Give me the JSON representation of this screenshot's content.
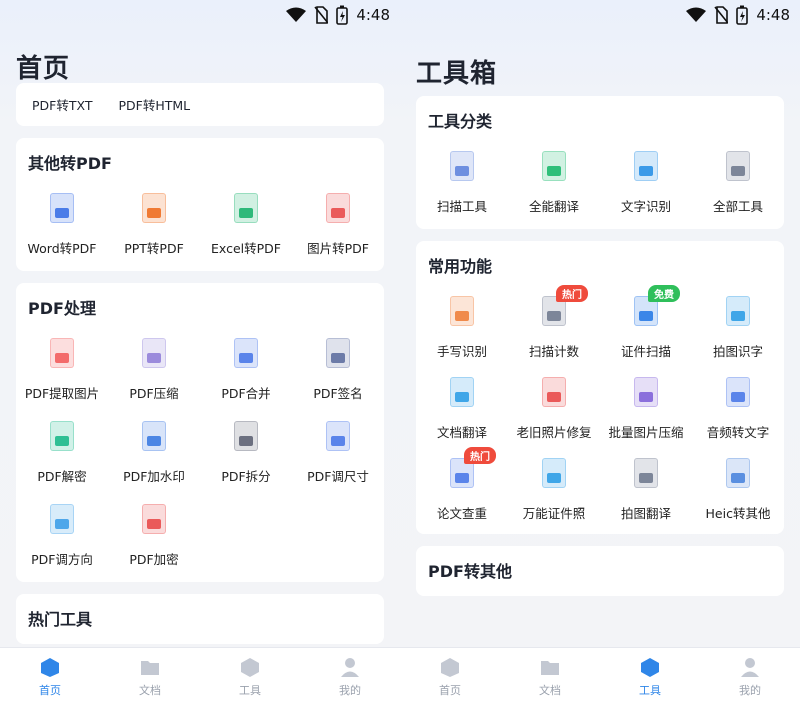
{
  "status": {
    "time": "4:48"
  },
  "left": {
    "title": "首页",
    "top_items": [
      "PDF转TXT",
      "PDF转HTML"
    ],
    "other_to_pdf": {
      "title": "其他转PDF",
      "items": [
        {
          "label": "Word转PDF",
          "icon": "word-to-pdf-icon",
          "color": "#4a7ce8"
        },
        {
          "label": "PPT转PDF",
          "icon": "ppt-to-pdf-icon",
          "color": "#f07a33"
        },
        {
          "label": "Excel转PDF",
          "icon": "excel-to-pdf-icon",
          "color": "#2eb97a"
        },
        {
          "label": "图片转PDF",
          "icon": "image-to-pdf-icon",
          "color": "#ea5a5a"
        }
      ]
    },
    "pdf_processing": {
      "title": "PDF处理",
      "items": [
        {
          "label": "PDF提取图片",
          "icon": "pdf-extract-image-icon",
          "color": "#f36b6b"
        },
        {
          "label": "PDF压缩",
          "icon": "pdf-compress-icon",
          "color": "#9b8bdc"
        },
        {
          "label": "PDF合并",
          "icon": "pdf-merge-icon",
          "color": "#5a84ea"
        },
        {
          "label": "PDF签名",
          "icon": "pdf-sign-icon",
          "color": "#6c7ba8"
        },
        {
          "label": "PDF解密",
          "icon": "pdf-decrypt-icon",
          "color": "#2fbf94"
        },
        {
          "label": "PDF加水印",
          "icon": "pdf-watermark-icon",
          "color": "#4c86e4"
        },
        {
          "label": "PDF拆分",
          "icon": "pdf-split-icon",
          "color": "#6c7080"
        },
        {
          "label": "PDF调尺寸",
          "icon": "pdf-resize-icon",
          "color": "#5a84ea"
        },
        {
          "label": "PDF调方向",
          "icon": "pdf-rotate-icon",
          "color": "#4ea7ea"
        },
        {
          "label": "PDF加密",
          "icon": "pdf-encrypt-icon",
          "color": "#ea5a5a"
        }
      ]
    },
    "hot_tools": {
      "title": "热门工具"
    }
  },
  "right": {
    "title": "工具箱",
    "categories": {
      "title": "工具分类",
      "items": [
        {
          "label": "扫描工具",
          "icon": "scan-icon",
          "color": "#6e8fe0"
        },
        {
          "label": "全能翻译",
          "icon": "translate-icon",
          "color": "#2fbf7a"
        },
        {
          "label": "文字识别",
          "icon": "text-recognition-icon",
          "color": "#3b9ae8"
        },
        {
          "label": "全部工具",
          "icon": "all-tools-icon",
          "color": "#7d8699"
        }
      ]
    },
    "common": {
      "title": "常用功能",
      "items": [
        {
          "label": "手写识别",
          "icon": "handwriting-icon",
          "color": "#f08a4b"
        },
        {
          "label": "扫描计数",
          "icon": "scan-count-icon",
          "color": "#7d8699",
          "badge": "热门"
        },
        {
          "label": "证件扫描",
          "icon": "id-scan-icon",
          "color": "#3b86e8",
          "badge": "免费"
        },
        {
          "label": "拍图识字",
          "icon": "photo-text-icon",
          "color": "#3fa6e8"
        },
        {
          "label": "文档翻译",
          "icon": "doc-translate-icon",
          "color": "#3fa6e8"
        },
        {
          "label": "老旧照片修复",
          "icon": "photo-restore-icon",
          "color": "#ea5a5a"
        },
        {
          "label": "批量图片压缩",
          "icon": "batch-compress-icon",
          "color": "#8b6fdc"
        },
        {
          "label": "音频转文字",
          "icon": "audio-to-text-icon",
          "color": "#5a84ea"
        },
        {
          "label": "论文查重",
          "icon": "paper-check-icon",
          "color": "#5a84ea",
          "badge": "热门"
        },
        {
          "label": "万能证件照",
          "icon": "id-photo-icon",
          "color": "#3fa6e8"
        },
        {
          "label": "拍图翻译",
          "icon": "photo-translate-icon",
          "color": "#7d8699"
        },
        {
          "label": "Heic转其他",
          "icon": "heic-convert-icon",
          "color": "#5a8fe0"
        }
      ]
    },
    "pdf_to_other": {
      "title": "PDF转其他"
    }
  },
  "tabs": [
    {
      "label": "首页",
      "icon": "home-icon"
    },
    {
      "label": "文档",
      "icon": "folder-icon"
    },
    {
      "label": "工具",
      "icon": "tools-icon"
    },
    {
      "label": "我的",
      "icon": "profile-icon"
    }
  ],
  "colors": {
    "accent": "#2f86e8",
    "tab_inactive": "#c3c8d2"
  }
}
